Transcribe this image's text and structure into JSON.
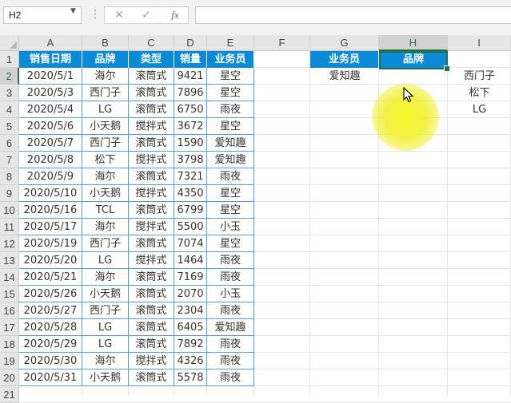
{
  "formula_bar": {
    "name_box": "H2",
    "cancel_icon": "close-icon",
    "enter_icon": "check-icon",
    "function_label": "fx",
    "formula_value": ""
  },
  "columns": [
    "A",
    "B",
    "C",
    "D",
    "E",
    "F",
    "G",
    "H",
    "I"
  ],
  "selected_column": "H",
  "selected_row": 2,
  "table": {
    "headers": [
      "销售日期",
      "品牌",
      "类型",
      "销量",
      "业务员"
    ],
    "rows": [
      [
        "2020/5/1",
        "海尔",
        "滚筒式",
        "9421",
        "星空"
      ],
      [
        "2020/5/3",
        "西门子",
        "滚筒式",
        "7896",
        "星空"
      ],
      [
        "2020/5/4",
        "LG",
        "滚筒式",
        "6750",
        "雨夜"
      ],
      [
        "2020/5/6",
        "小天鹅",
        "搅拌式",
        "3672",
        "星空"
      ],
      [
        "2020/5/7",
        "西门子",
        "滚筒式",
        "1590",
        "爱知趣"
      ],
      [
        "2020/5/8",
        "松下",
        "搅拌式",
        "3798",
        "爱知趣"
      ],
      [
        "2020/5/9",
        "海尔",
        "滚筒式",
        "7321",
        "雨夜"
      ],
      [
        "2020/5/10",
        "小天鹅",
        "搅拌式",
        "4350",
        "星空"
      ],
      [
        "2020/5/16",
        "TCL",
        "滚筒式",
        "6799",
        "星空"
      ],
      [
        "2020/5/17",
        "海尔",
        "搅拌式",
        "5500",
        "小玉"
      ],
      [
        "2020/5/19",
        "西门子",
        "滚筒式",
        "7074",
        "星空"
      ],
      [
        "2020/5/20",
        "LG",
        "搅拌式",
        "1464",
        "雨夜"
      ],
      [
        "2020/5/21",
        "海尔",
        "滚筒式",
        "7169",
        "雨夜"
      ],
      [
        "2020/5/26",
        "小天鹅",
        "滚筒式",
        "2070",
        "小玉"
      ],
      [
        "2020/5/27",
        "西门子",
        "滚筒式",
        "2304",
        "雨夜"
      ],
      [
        "2020/5/28",
        "LG",
        "滚筒式",
        "6405",
        "爱知趣"
      ],
      [
        "2020/5/29",
        "LG",
        "滚筒式",
        "7892",
        "雨夜"
      ],
      [
        "2020/5/30",
        "海尔",
        "搅拌式",
        "4326",
        "雨夜"
      ],
      [
        "2020/5/31",
        "小天鹅",
        "滚筒式",
        "5578",
        "雨夜"
      ]
    ]
  },
  "lookup": {
    "g_header": "业务员",
    "h_header": "品牌",
    "g2": "爱知趣",
    "i_values": [
      "西门子",
      "松下",
      "LG"
    ]
  },
  "colors": {
    "header_fill": "#0b8ad6",
    "border": "#5b9bd5",
    "selection": "#217346",
    "highlight": "#f5f51e"
  }
}
